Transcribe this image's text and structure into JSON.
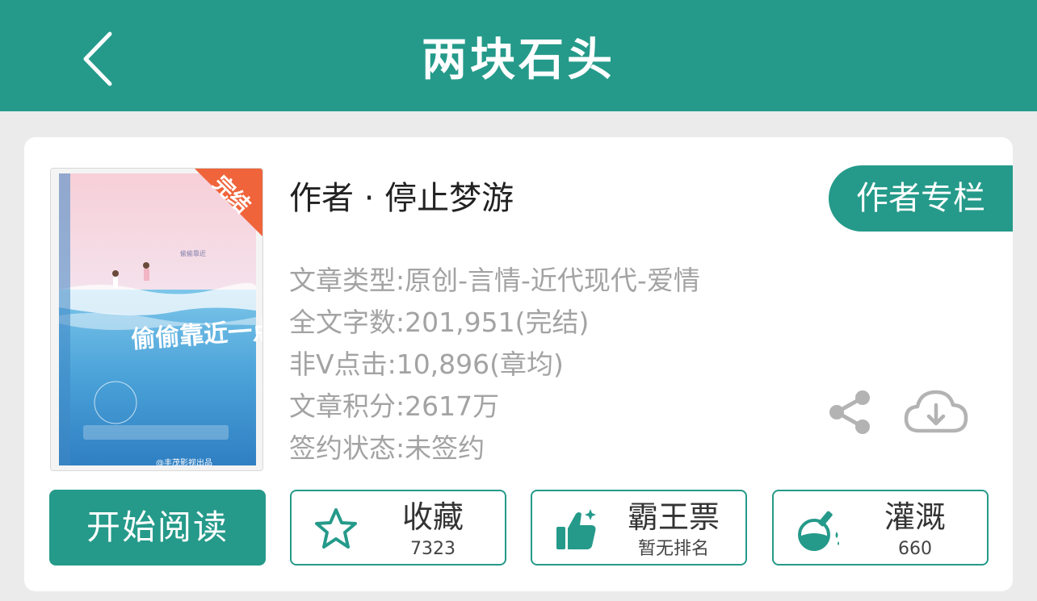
{
  "header": {
    "title": "两块石头"
  },
  "book": {
    "author_line": "作者 · 停止梦游",
    "author_column_label": "作者专栏",
    "cover": {
      "badge": "完结",
      "title": "偷偷靠近一点点",
      "watermark": "@丰茂影视出品"
    },
    "info": [
      "文章类型:原创-言情-近代现代-爱情",
      "全文字数:201,951(完结)",
      "非V点击:10,896(章均)",
      "文章积分:2617万",
      "签约状态:未签约"
    ]
  },
  "actions": {
    "start_reading": "开始阅读",
    "favorite": {
      "label": "收藏",
      "sub": "7323"
    },
    "bawangpiao": {
      "label": "霸王票",
      "sub": "暂无排名"
    },
    "irrigate": {
      "label": "灌溉",
      "sub": "660"
    }
  },
  "icons": {
    "back": "chevron-left-icon",
    "share": "share-icon",
    "download": "cloud-download-icon",
    "favorite": "star-icon",
    "bawangpiao": "thumbs-up-icon",
    "irrigate": "flask-icon"
  },
  "colors": {
    "accent": "#259a8a",
    "badge": "#f0643c",
    "muted_text": "#a3a3a3"
  }
}
